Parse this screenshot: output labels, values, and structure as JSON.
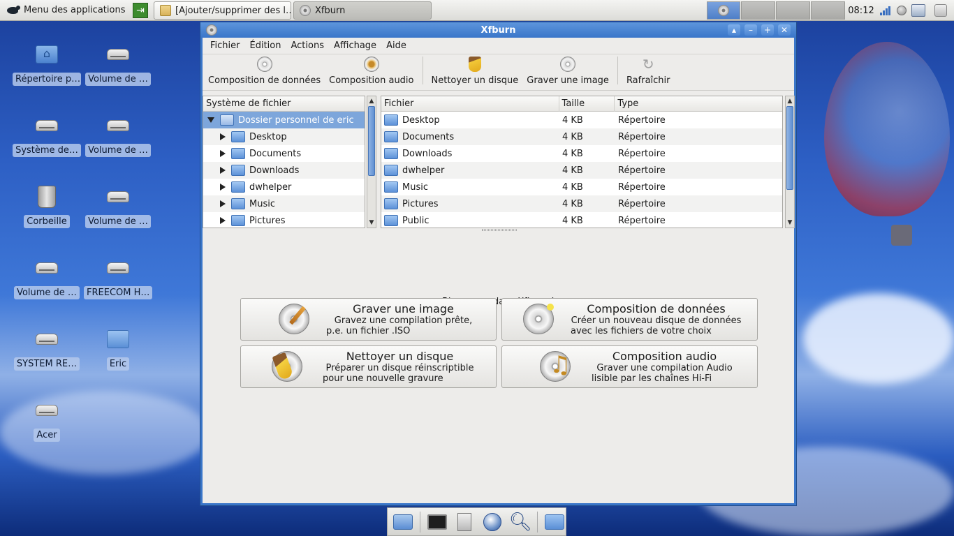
{
  "top_panel": {
    "apps_menu_label": "Menu des applications",
    "tasks": [
      {
        "label": "[Ajouter/supprimer des l…",
        "active": false
      },
      {
        "label": "Xfburn",
        "active": true
      }
    ],
    "clock": "08:12"
  },
  "desktop": {
    "icons": [
      {
        "label": "Répertoire p…",
        "kind": "home-folder-icon"
      },
      {
        "label": "Volume de …",
        "kind": "drive-icon"
      },
      {
        "label": "Système de…",
        "kind": "drive-icon"
      },
      {
        "label": "Volume de …",
        "kind": "drive-icon"
      },
      {
        "label": "Corbeille",
        "kind": "trash-icon"
      },
      {
        "label": "Volume de …",
        "kind": "drive-icon"
      },
      {
        "label": "Volume de …",
        "kind": "drive-icon"
      },
      {
        "label": "FREECOM H…",
        "kind": "drive-icon"
      },
      {
        "label": "SYSTEM RE…",
        "kind": "drive-icon"
      },
      {
        "label": "Eric",
        "kind": "folder-icon"
      },
      {
        "label": "Acer",
        "kind": "drive-icon"
      }
    ]
  },
  "window": {
    "title": "Xfburn",
    "menu": [
      "Fichier",
      "Édition",
      "Actions",
      "Affichage",
      "Aide"
    ],
    "toolbar": {
      "data_composition": "Composition de données",
      "audio_composition": "Composition audio",
      "blank_disc": "Nettoyer un disque",
      "burn_image": "Graver une image",
      "refresh": "Rafraîchir"
    },
    "tree": {
      "header": "Système de fichier",
      "root": "Dossier personnel de eric",
      "children": [
        "Desktop",
        "Documents",
        "Downloads",
        "dwhelper",
        "Music",
        "Pictures"
      ]
    },
    "files": {
      "headers": {
        "name": "Fichier",
        "size": "Taille",
        "type": "Type"
      },
      "rows": [
        {
          "name": "Desktop",
          "size": "4 KB",
          "type": "Répertoire"
        },
        {
          "name": "Documents",
          "size": "4 KB",
          "type": "Répertoire"
        },
        {
          "name": "Downloads",
          "size": "4 KB",
          "type": "Répertoire"
        },
        {
          "name": "dwhelper",
          "size": "4 KB",
          "type": "Répertoire"
        },
        {
          "name": "Music",
          "size": "4 KB",
          "type": "Répertoire"
        },
        {
          "name": "Pictures",
          "size": "4 KB",
          "type": "Répertoire"
        },
        {
          "name": "Public",
          "size": "4 KB",
          "type": "Répertoire"
        }
      ]
    },
    "welcome": {
      "text": "Bienvenue dans Xfburn !",
      "buttons": {
        "burn_image": {
          "title": "Graver une image",
          "line1": "Gravez une compilation prête,",
          "line2": "p.e. un fichier .ISO"
        },
        "data_composition": {
          "title": "Composition de données",
          "line1": "Créer un nouveau disque de données",
          "line2": "avec les fichiers de votre choix"
        },
        "blank_disc": {
          "title": "Nettoyer un disque",
          "line1": "Préparer un disque réinscriptible",
          "line2": "pour une nouvelle gravure"
        },
        "audio_composition": {
          "title": "Composition audio",
          "line1": "Graver une compilation Audio",
          "line2": "lisible par les chaînes Hi-Fi"
        }
      }
    }
  },
  "colors": {
    "accent": "#3a76c9",
    "selection": "#7da6db",
    "window_bg": "#edecea"
  }
}
